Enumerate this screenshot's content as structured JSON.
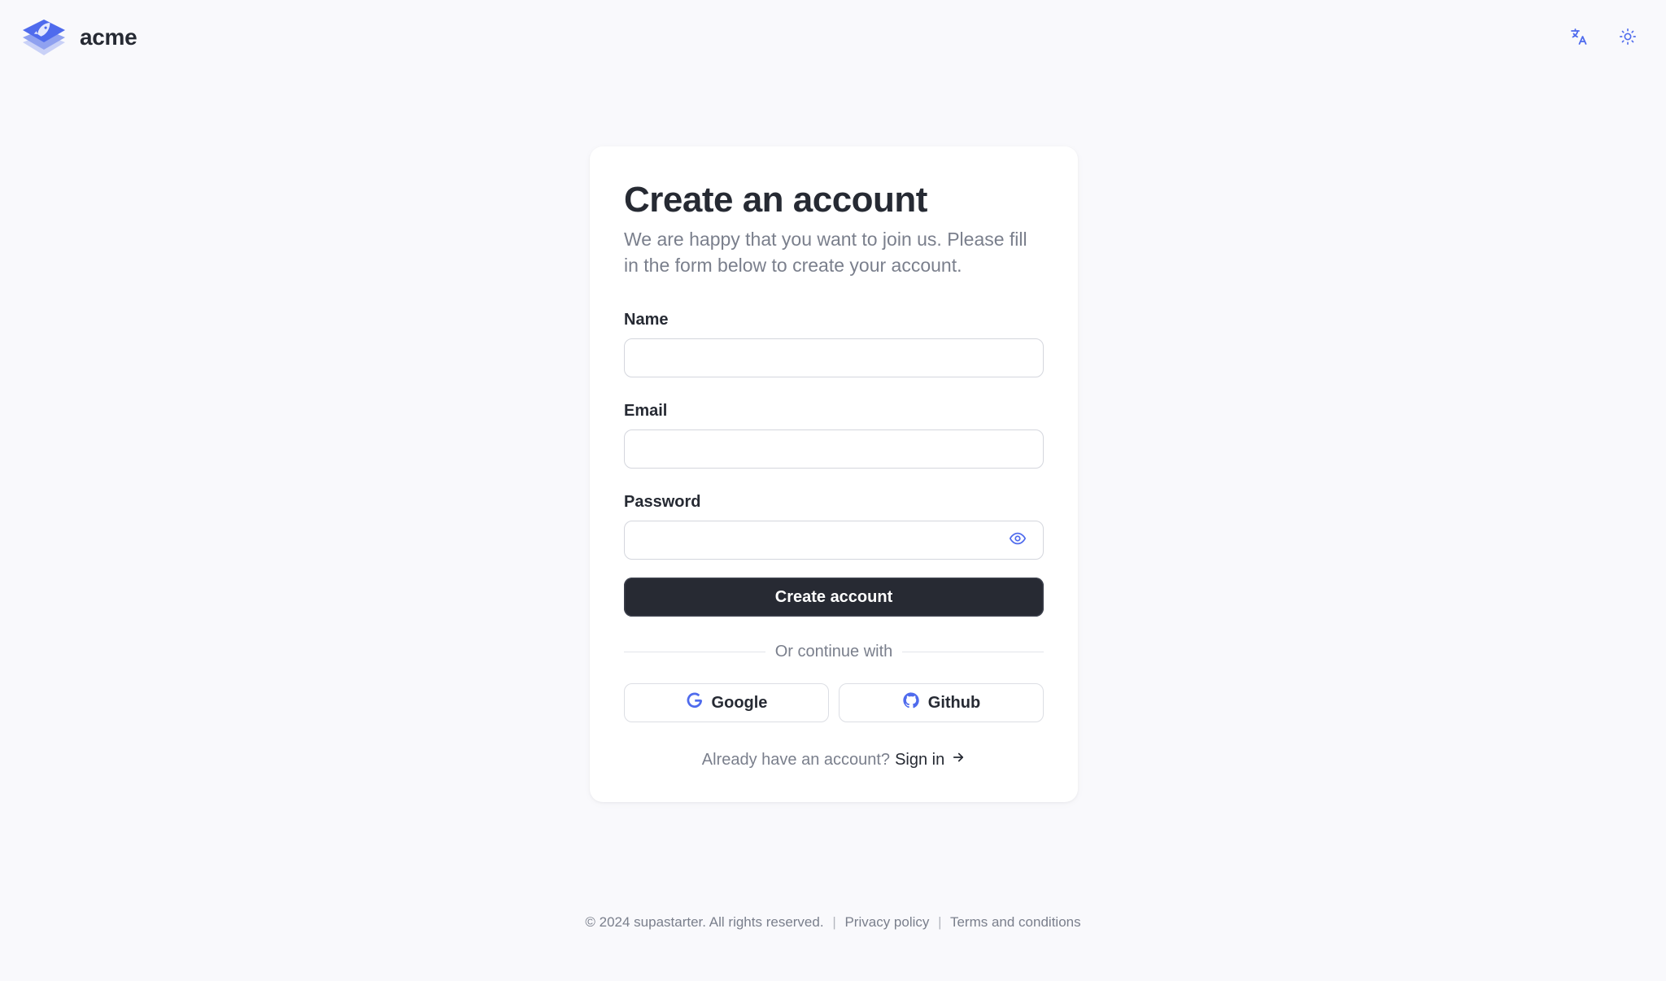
{
  "brand": {
    "name": "acme",
    "logo_icon": "rocket-layers-logo-icon",
    "accent_color": "#4f6bed"
  },
  "header": {
    "language_icon": "translate-icon",
    "theme_icon": "sun-icon"
  },
  "card": {
    "title": "Create an account",
    "subtitle": "We are happy that you want to join us. Please fill in the form below to create your account.",
    "fields": {
      "name": {
        "label": "Name",
        "value": ""
      },
      "email": {
        "label": "Email",
        "value": ""
      },
      "password": {
        "label": "Password",
        "value": "",
        "toggle_icon": "eye-icon"
      }
    },
    "submit_label": "Create account",
    "divider_text": "Or continue with",
    "social": {
      "google": {
        "label": "Google",
        "icon": "google-icon"
      },
      "github": {
        "label": "Github",
        "icon": "github-icon"
      }
    },
    "signin": {
      "prompt": "Already have an account?",
      "link_label": "Sign in",
      "arrow_icon": "arrow-right-icon"
    }
  },
  "footer": {
    "copyright": "© 2024 supastarter. All rights reserved.",
    "separator": "|",
    "privacy_label": "Privacy policy",
    "terms_label": "Terms and conditions"
  },
  "colors": {
    "background": "#f9f9fc",
    "card": "#ffffff",
    "primary_button": "#272a33",
    "muted_text": "#7a7f8c",
    "icon_accent": "#4f6bed"
  }
}
